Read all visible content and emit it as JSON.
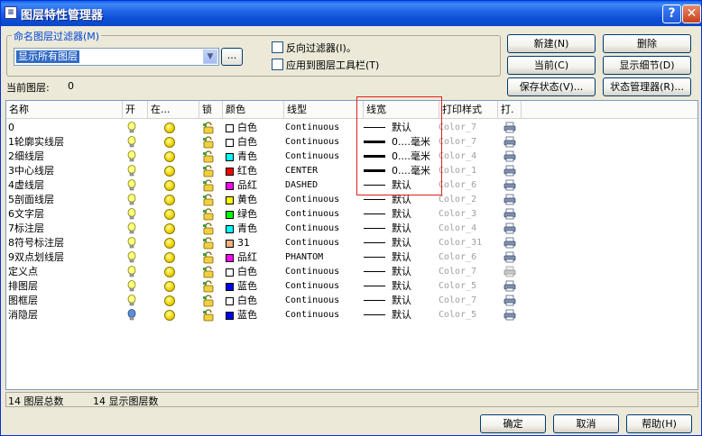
{
  "window": {
    "title": "图层特性管理器",
    "help_label": "?",
    "close_label": "✕",
    "app_icon": "layers-icon"
  },
  "filter": {
    "group_label": "命名图层过滤器(M)",
    "selected": "显示所有图层",
    "ellipsis_label": "...",
    "invert_label": "反向过滤器(I)。",
    "apply_toolbar_label": "应用到图层工具栏(T)"
  },
  "buttons": {
    "new": "新建(N)",
    "delete": "删除",
    "current": "当前(C)",
    "show_details": "显示细节(D)",
    "save_state": "保存状态(V)...",
    "state_manager": "状态管理器(R)...",
    "ok": "确定",
    "cancel": "取消",
    "help": "帮助(H)"
  },
  "current_layer": {
    "label": "当前图层:",
    "value": "0"
  },
  "columns": [
    "名称",
    "开",
    "在...",
    "锁",
    "颜色",
    "线型",
    "线宽",
    "打印样式",
    "打."
  ],
  "rows": [
    {
      "name": "0",
      "color_name": "白色",
      "color_hex": "#ffffff",
      "linetype": "Continuous",
      "lineweight": "默认",
      "lw_bold": false,
      "plot_style": "Color_7",
      "bulb": "on",
      "plot": true
    },
    {
      "name": "1轮廓实线层",
      "color_name": "白色",
      "color_hex": "#ffffff",
      "linetype": "Continuous",
      "lineweight": "0....毫米",
      "lw_bold": true,
      "plot_style": "Color_7",
      "bulb": "on",
      "plot": true
    },
    {
      "name": "2细线层",
      "color_name": "青色",
      "color_hex": "#00ffff",
      "linetype": "Continuous",
      "lineweight": "0....毫米",
      "lw_bold": true,
      "plot_style": "Color_4",
      "bulb": "on",
      "plot": true
    },
    {
      "name": "3中心线层",
      "color_name": "红色",
      "color_hex": "#ff0000",
      "linetype": "CENTER",
      "lineweight": "0....毫米",
      "lw_bold": true,
      "plot_style": "Color_1",
      "bulb": "on",
      "plot": true
    },
    {
      "name": "4虚线层",
      "color_name": "品红",
      "color_hex": "#ff00ff",
      "linetype": "DASHED",
      "lineweight": "默认",
      "lw_bold": false,
      "plot_style": "Color_6",
      "bulb": "on",
      "plot": true
    },
    {
      "name": "5剖面线层",
      "color_name": "黄色",
      "color_hex": "#ffff00",
      "linetype": "Continuous",
      "lineweight": "默认",
      "lw_bold": false,
      "plot_style": "Color_2",
      "bulb": "on",
      "plot": true
    },
    {
      "name": "6文字层",
      "color_name": "绿色",
      "color_hex": "#00ff00",
      "linetype": "Continuous",
      "lineweight": "默认",
      "lw_bold": false,
      "plot_style": "Color_3",
      "bulb": "on",
      "plot": true
    },
    {
      "name": "7标注层",
      "color_name": "青色",
      "color_hex": "#00ffff",
      "linetype": "Continuous",
      "lineweight": "默认",
      "lw_bold": false,
      "plot_style": "Color_4",
      "bulb": "on",
      "plot": true
    },
    {
      "name": "8符号标注层",
      "color_name": "31",
      "color_hex": "#f0b080",
      "linetype": "Continuous",
      "lineweight": "默认",
      "lw_bold": false,
      "plot_style": "Color_31",
      "bulb": "on",
      "plot": true
    },
    {
      "name": "9双点划线层",
      "color_name": "品红",
      "color_hex": "#ff00ff",
      "linetype": "PHANTOM",
      "lineweight": "默认",
      "lw_bold": false,
      "plot_style": "Color_6",
      "bulb": "on",
      "plot": true
    },
    {
      "name": "定义点",
      "color_name": "白色",
      "color_hex": "#ffffff",
      "linetype": "Continuous",
      "lineweight": "默认",
      "lw_bold": false,
      "plot_style": "Color_7",
      "bulb": "on",
      "plot": false
    },
    {
      "name": "排图层",
      "color_name": "蓝色",
      "color_hex": "#0000ff",
      "linetype": "Continuous",
      "lineweight": "默认",
      "lw_bold": false,
      "plot_style": "Color_5",
      "bulb": "on",
      "plot": true
    },
    {
      "name": "图框层",
      "color_name": "白色",
      "color_hex": "#ffffff",
      "linetype": "Continuous",
      "lineweight": "默认",
      "lw_bold": false,
      "plot_style": "Color_7",
      "bulb": "on",
      "plot": true
    },
    {
      "name": "消隐层",
      "color_name": "蓝色",
      "color_hex": "#0000ff",
      "linetype": "Continuous",
      "lineweight": "默认",
      "lw_bold": false,
      "plot_style": "Color_5",
      "bulb": "off",
      "plot": true
    }
  ],
  "status": {
    "total": "14 图层总数",
    "shown": "14 显示图层数"
  }
}
